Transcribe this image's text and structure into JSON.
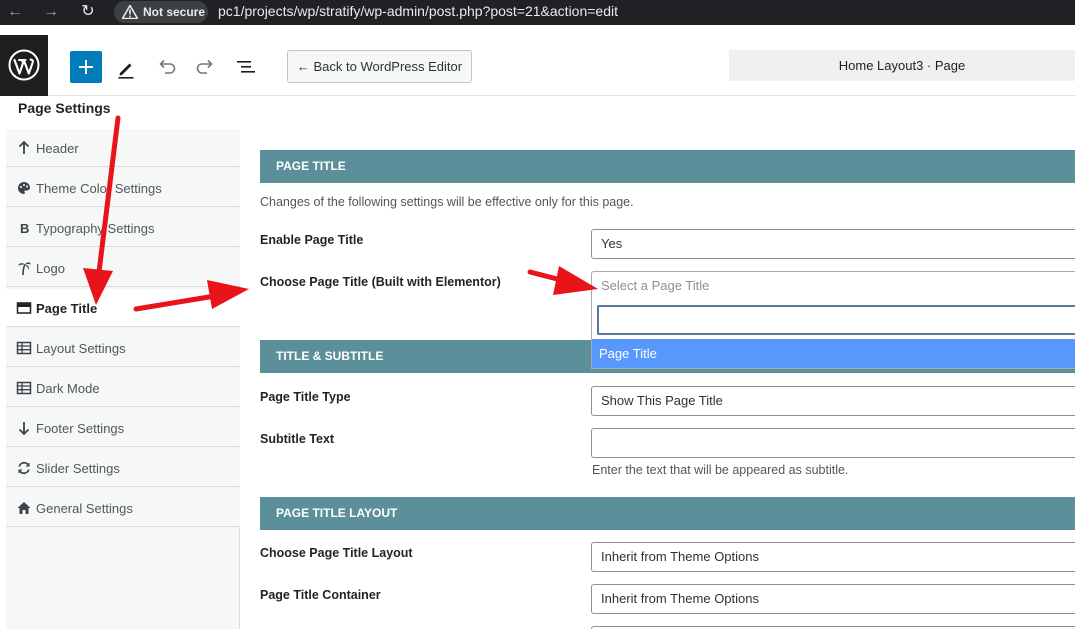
{
  "browser": {
    "back_glyph": "←",
    "forward_glyph": "→",
    "reload_glyph": "↻",
    "security_label": "Not secure",
    "url": "pc1/projects/wp/stratify/wp-admin/post.php?post=21&action=edit"
  },
  "toolbar": {
    "back_button_label": "← Back to WordPress Editor",
    "document_title": "Home Layout3 · Page"
  },
  "sidebar": {
    "title": "Page Settings",
    "items": [
      {
        "label": "Header",
        "icon": "arrow-up-icon",
        "active": false
      },
      {
        "label": "Theme Color Settings",
        "icon": "palette-icon",
        "active": false
      },
      {
        "label": "Typography Settings",
        "icon": "bold-icon",
        "active": false
      },
      {
        "label": "Logo",
        "icon": "palm-tree-icon",
        "active": false
      },
      {
        "label": "Page Title",
        "icon": "page-title-icon",
        "active": true
      },
      {
        "label": "Layout Settings",
        "icon": "table-icon",
        "active": false
      },
      {
        "label": "Dark Mode",
        "icon": "table-icon",
        "active": false
      },
      {
        "label": "Footer Settings",
        "icon": "arrow-down-icon",
        "active": false
      },
      {
        "label": "Slider Settings",
        "icon": "refresh-icon",
        "active": false
      },
      {
        "label": "General Settings",
        "icon": "home-icon",
        "active": false
      }
    ]
  },
  "main": {
    "sections": {
      "page_title": "PAGE TITLE",
      "title_subtitle": "TITLE & SUBTITLE",
      "page_title_layout": "PAGE TITLE LAYOUT"
    },
    "description": "Changes of the following settings will be effective only for this page.",
    "fields": {
      "enable_page_title": {
        "label": "Enable Page Title",
        "value": "Yes"
      },
      "choose_page_title": {
        "label": "Choose Page Title (Built with Elementor)",
        "placeholder": "Select a Page Title",
        "search_value": "",
        "options": [
          "Page Title"
        ]
      },
      "page_title_type": {
        "label": "Page Title Type",
        "value": "Show This Page Title"
      },
      "subtitle_text": {
        "label": "Subtitle Text",
        "value": "",
        "help": "Enter the text that will be appeared as subtitle."
      },
      "page_title_layout": {
        "label": "Choose Page Title Layout",
        "value": "Inherit from Theme Options"
      },
      "page_title_container": {
        "label": "Page Title Container",
        "value": "Inherit from Theme Options"
      }
    }
  },
  "colors": {
    "accent": "#007cba",
    "section_header": "#5b8f99",
    "option_highlight": "#5897fb",
    "annotation_arrow": "#e8141a"
  }
}
